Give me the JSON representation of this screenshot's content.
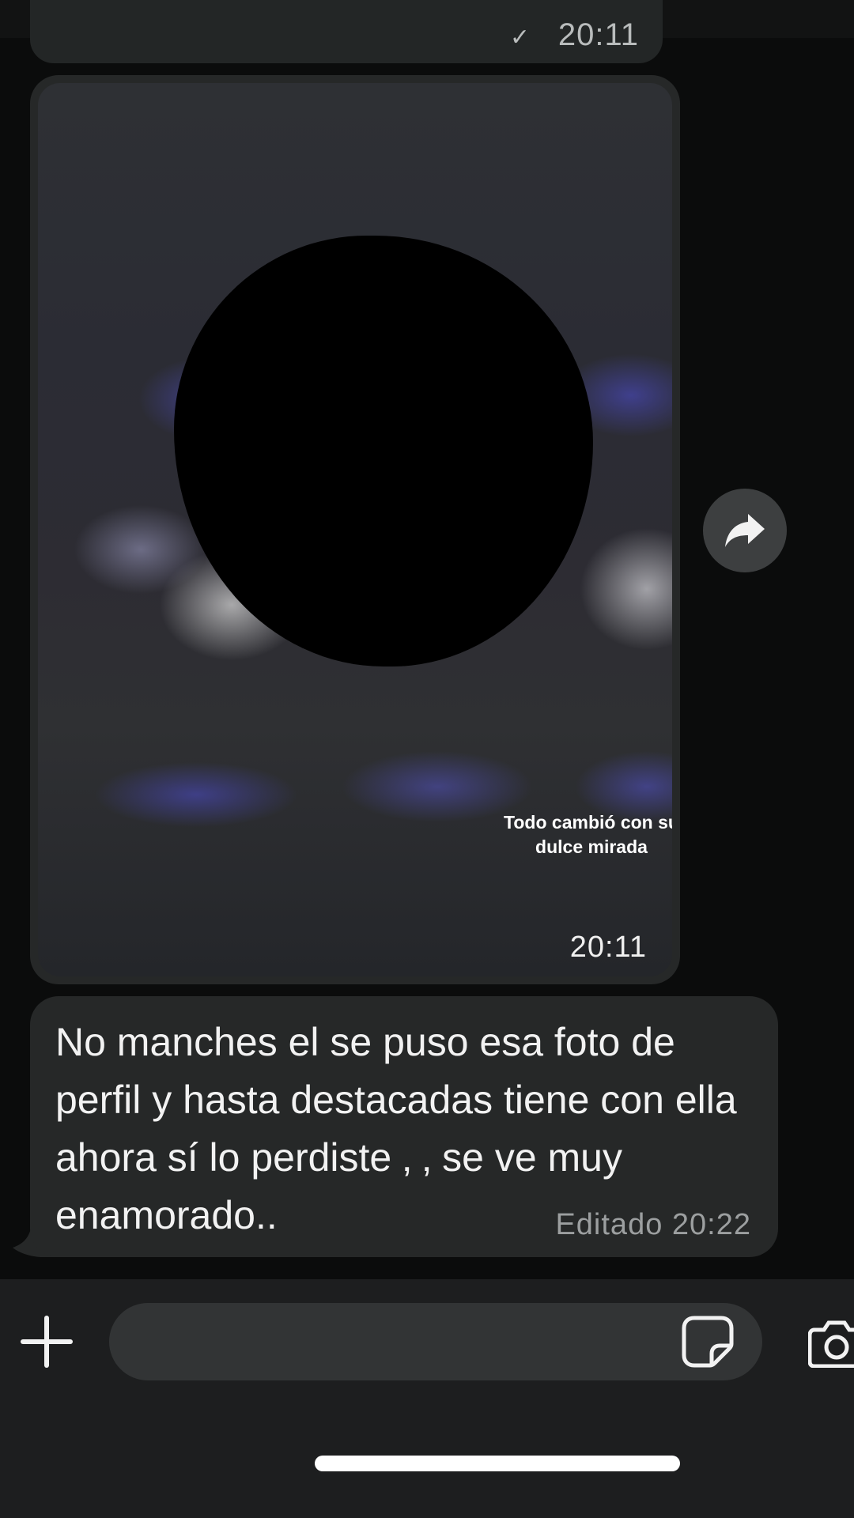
{
  "previous_message": {
    "time": "20:11"
  },
  "image_message": {
    "caption": "Todo cambió con su dulce mirada",
    "time": "20:11"
  },
  "text_message": {
    "text": "No manches el se puso esa foto de perfil y hasta destacadas tiene con ella ahora sí lo perdiste ‚     ‚ se ve muy enamorado..",
    "edited_label": "Editado",
    "time": "20:22"
  },
  "icons": {
    "forward": "forward-arrow-icon",
    "add": "plus-icon",
    "sticker": "sticker-icon",
    "camera": "camera-icon"
  },
  "composer": {
    "value": "",
    "placeholder": ""
  },
  "colors": {
    "background": "#0b0c0c",
    "bubble": "#262828",
    "composer_bar": "#1d1e1f",
    "input_field": "#323435",
    "meta_text": "#9c9fa0"
  }
}
